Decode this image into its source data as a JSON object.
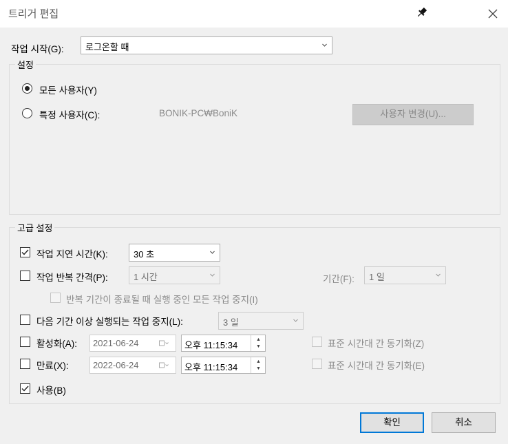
{
  "window": {
    "title": "트리거 편집"
  },
  "begin_task": {
    "label": "작업 시작(G):",
    "value": "로그온할 때"
  },
  "settings": {
    "legend": "설정",
    "any_user_label": "모든 사용자(Y)",
    "specific_user_label": "특정 사용자(C):",
    "user_name": "BONIK-PC₩BoniK",
    "change_user_button": "사용자 변경(U)...",
    "selected": "any_user"
  },
  "advanced": {
    "legend": "고급 설정",
    "delay": {
      "label": "작업 지연 시간(K):",
      "value": "30 초",
      "checked": true
    },
    "repeat": {
      "label": "작업 반복 간격(P):",
      "value": "1 시간",
      "checked": false,
      "duration_label": "기간(F):",
      "duration_value": "1 일"
    },
    "stop_repeat": {
      "label": "반복 기간이 종료될 때 실행 중인 모든 작업 중지(I)",
      "checked": false
    },
    "stop_longer": {
      "label": "다음 기간 이상 실행되는 작업 중지(L):",
      "value": "3 일",
      "checked": false
    },
    "activate": {
      "label": "활성화(A):",
      "date": "2021-06-24",
      "time": "오후 11:15:34",
      "sync_label": "표준 시간대 간 동기화(Z)",
      "checked": false
    },
    "expire": {
      "label": "만료(X):",
      "date": "2022-06-24",
      "time": "오후 11:15:34",
      "sync_label": "표준 시간대 간 동기화(E)",
      "checked": false
    },
    "enabled": {
      "label": "사용(B)",
      "checked": true
    }
  },
  "buttons": {
    "ok": "확인",
    "cancel": "취소"
  }
}
